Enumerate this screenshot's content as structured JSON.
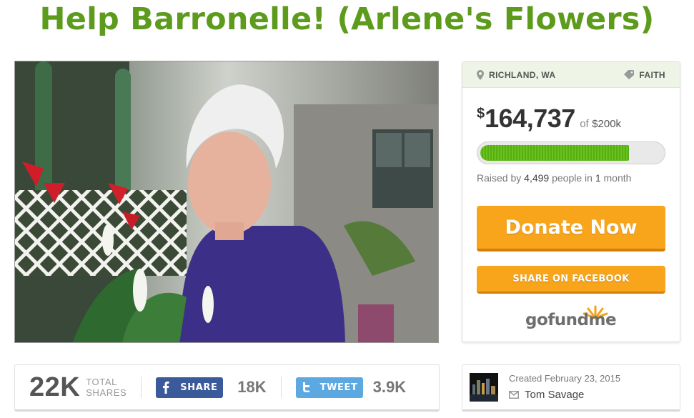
{
  "campaign": {
    "title": "Help Barronelle! (Arlene's Flowers)"
  },
  "photo": {
    "icon": "campaign-photo"
  },
  "sidebar": {
    "location": "RICHLAND, WA",
    "category": "FAITH",
    "currency_symbol": "$",
    "raised_amount": "164,737",
    "of_label": "of",
    "goal": "$200k",
    "progress_fraction": 0.82,
    "raised_prefix": "Raised by",
    "people_count": "4,499",
    "people_label": "people in",
    "duration_num": "1",
    "duration_unit": "month",
    "donate_label": "Donate Now",
    "share_facebook_label": "SHARE ON FACEBOOK",
    "logo_text_a": "go",
    "logo_text_b": "fund",
    "logo_text_c": "me",
    "colors": {
      "accent_orange": "#f8a51b",
      "progress_green": "#69c21e",
      "title_green": "#5c9b1c"
    }
  },
  "sharebar": {
    "total": "22K",
    "total_label_1": "TOTAL",
    "total_label_2": "SHARES",
    "facebook_label": "SHARE",
    "facebook_count": "18K",
    "twitter_label": "TWEET",
    "twitter_count": "3.9K"
  },
  "creator": {
    "created_text": "Created February 23, 2015",
    "name": "Tom Savage"
  }
}
